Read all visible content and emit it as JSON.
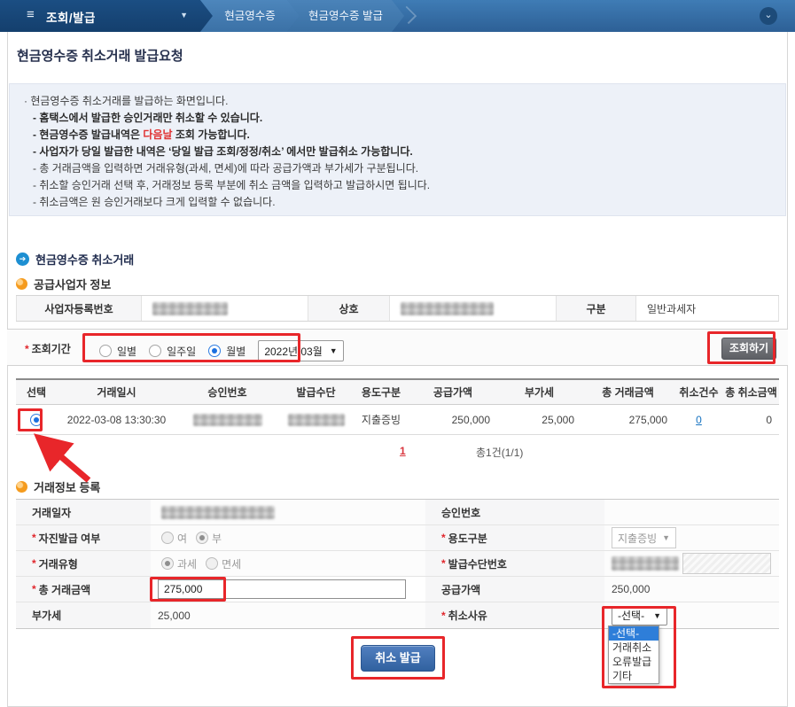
{
  "icons": {
    "hamburger": "≡",
    "caret_down": "▼",
    "chevron_down": "⌄",
    "section_arrow": "➔",
    "select_caret": "▼"
  },
  "topbar": {
    "menu_label": "조회/발급",
    "breadcrumb1": "현금영수증",
    "breadcrumb2": "현금영수증 발급"
  },
  "page_title": "현금영수증 취소거래 발급요청",
  "notice": {
    "line1": "· 현금영수증 취소거래를 발급하는 화면입니다.",
    "line2": "- 홈택스에서 발급한 승인거래만 취소할 수 있습니다.",
    "line3_pre": "- 현금영수증 발급내역은 ",
    "line3_red": "다음날",
    "line3_post": " 조회 가능합니다.",
    "line4": "- 사업자가 당일 발급한 내역은 ‘당일 발급 조회/정정/취소’ 에서만 발급취소 가능합니다.",
    "line5": "- 총 거래금액을 입력하면 거래유형(과세, 면세)에 따라 공급가액과 부가세가 구분됩니다.",
    "line6": "- 취소할 승인거래 선택 후, 거래정보 등록 부분에 취소 금액을 입력하고 발급하시면 됩니다.",
    "line7": "- 취소금액은 원 승인거래보다 크게 입력할 수 없습니다."
  },
  "sections": {
    "cancel_trade": "현금영수증 취소거래",
    "supplier_info": "공급사업자 정보",
    "register_info": "거래정보 등록"
  },
  "supplier": {
    "biz_no_label": "사업자등록번호",
    "trade_name_label": "상호",
    "type_label": "구분",
    "type_value": "일반과세자"
  },
  "query": {
    "label": "조회기간",
    "radio_daily": "일별",
    "radio_weekly": "일주일",
    "radio_monthly": "월별",
    "month_value": "2022년 03월",
    "search_button": "조회하기"
  },
  "results": {
    "columns": [
      "선택",
      "거래일시",
      "승인번호",
      "발급수단",
      "용도구분",
      "공급가액",
      "부가세",
      "총 거래금액",
      "취소건수",
      "총 취소금액"
    ],
    "row": {
      "datetime": "2022-03-08 13:30:30",
      "usage": "지출증빙",
      "supply_amount": "250,000",
      "vat": "25,000",
      "total_amount": "275,000",
      "cancel_count": "0",
      "total_cancel_amount": "0"
    },
    "page_number": "1",
    "total_text": "총1건(1/1)"
  },
  "register": {
    "trade_date_label": "거래일자",
    "approval_no_label": "승인번호",
    "self_issue_label": "자진발급 여부",
    "self_issue_yes": "여",
    "self_issue_no": "부",
    "usage_label": "용도구분",
    "usage_value": "지출증빙",
    "trade_type_label": "거래유형",
    "trade_type_taxable": "과세",
    "trade_type_exempt": "면세",
    "issue_means_label": "발급수단번호",
    "total_amount_label": "총 거래금액",
    "total_amount_value": "275,000",
    "supply_label": "공급가액",
    "supply_value": "250,000",
    "vat_label": "부가세",
    "vat_value": "25,000",
    "cancel_reason_label": "취소사유",
    "cancel_reason_value": "-선택-",
    "cancel_reason_options": [
      "-선택-",
      "거래취소",
      "오류발급",
      "기타"
    ]
  },
  "submit_button": "취소 발급",
  "colors": {
    "annotation_red": "#e8262a",
    "topbar_blue": "#2d6096",
    "accent_blue": "#30619f",
    "link_blue": "#1673c1",
    "notice_bg": "#edf1f8"
  }
}
